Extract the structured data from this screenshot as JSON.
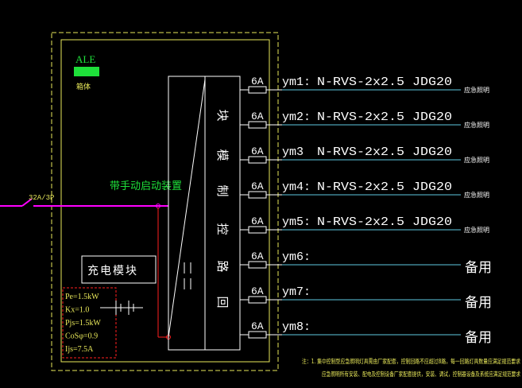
{
  "colors": {
    "background": "#000000",
    "frame": "#e8e85a",
    "module": "#ffffff",
    "wire": "#5ec8e0",
    "bus": "#ff00ff",
    "control_wire": "#ff2020",
    "green_label": "#1ee03a",
    "caption": "#e8e85a"
  },
  "panel": {
    "label": "ALE",
    "sublabel": "箱体"
  },
  "incoming": {
    "breaker_label": "32A/3P",
    "device_label": "带手动启动装置"
  },
  "module": {
    "vertical_label": [
      "块",
      "模",
      "制",
      "控",
      "路",
      "回"
    ]
  },
  "charging_module": {
    "label": "充电模块",
    "params": [
      "Pe=1.5kW",
      "Kx=1.0",
      "Pjs=1.5kW",
      "CoSφ=0.9",
      "Ijs=7.5A"
    ]
  },
  "circuits": [
    {
      "fuse": "6A",
      "id": "ym1:",
      "cable": "N-RVS-2x2.5 JDG20",
      "load": "应急照明"
    },
    {
      "fuse": "6A",
      "id": "ym2:",
      "cable": "N-RVS-2x2.5 JDG20",
      "load": "应急照明"
    },
    {
      "fuse": "6A",
      "id": "ym3",
      "cable": "N-RVS-2x2.5 JDG20",
      "load": "应急照明"
    },
    {
      "fuse": "6A",
      "id": "ym4:",
      "cable": "N-RVS-2x2.5 JDG20",
      "load": "应急照明"
    },
    {
      "fuse": "6A",
      "id": "ym5:",
      "cable": "N-RVS-2x2.5 JDG20",
      "load": "应急照明"
    },
    {
      "fuse": "6A",
      "id": "ym6:",
      "cable": "",
      "load": "备用"
    },
    {
      "fuse": "6A",
      "id": "ym7:",
      "cable": "",
      "load": "备用"
    },
    {
      "fuse": "6A",
      "id": "ym8:",
      "cable": "",
      "load": "备用"
    }
  ],
  "note": {
    "line1": "注：1. 集中控制型应急照明灯具需由厂家配套，控制回路不应超过8路，每一回路灯具数量应满足规范要求",
    "line2": "应急照明所有安装、配电及控制设备厂家配套提供，安装、调试，控制器设备及系统应满足规范要求"
  }
}
